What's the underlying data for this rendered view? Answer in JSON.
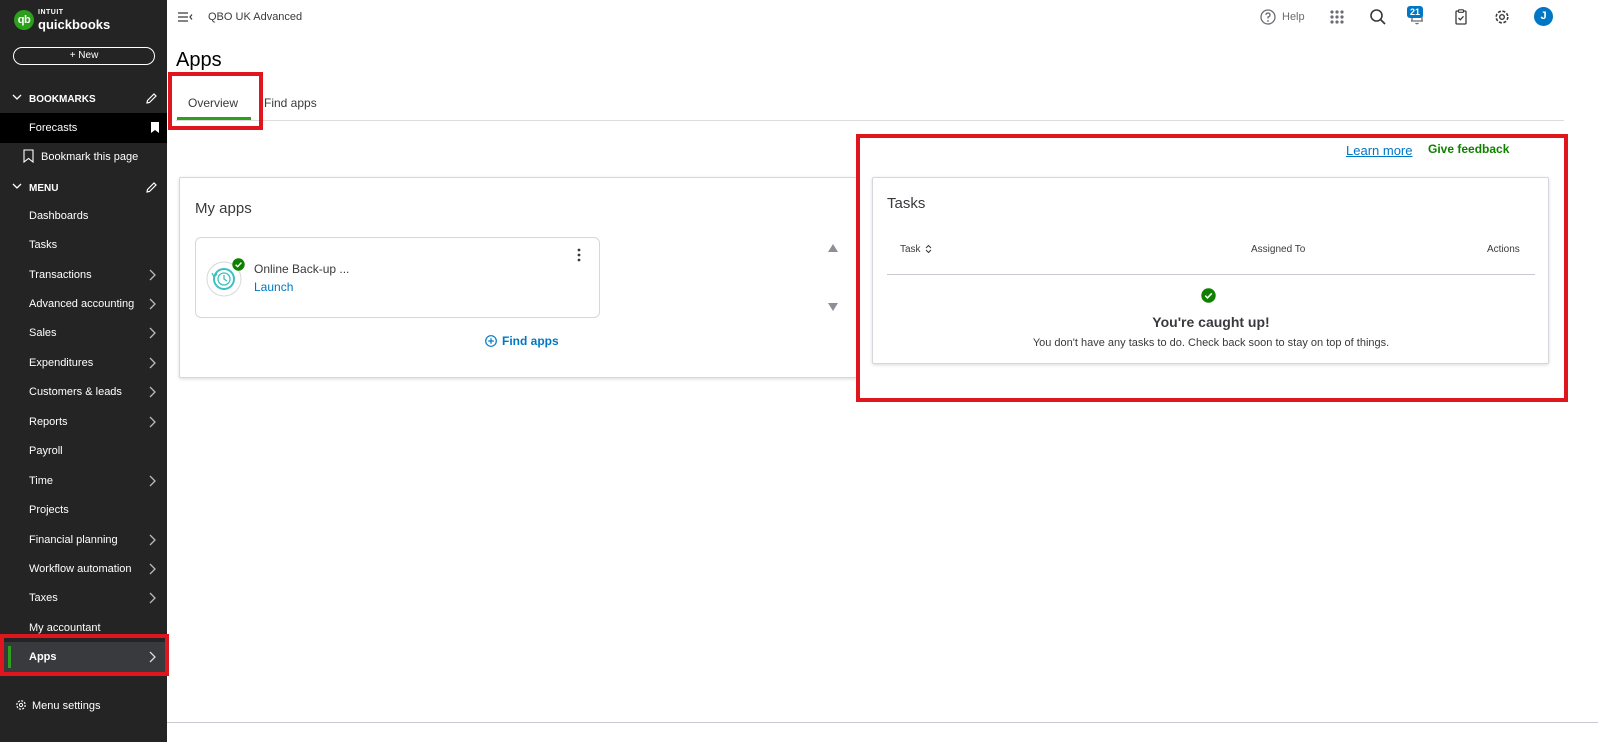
{
  "brand": {
    "intuit": "INTUIT",
    "product": "quickbooks",
    "mark": "qb"
  },
  "sidebar": {
    "new_label": "+  New",
    "bookmarks_heading": "BOOKMARKS",
    "bookmarks": [
      {
        "label": "Forecasts"
      }
    ],
    "bookmark_this_page": "Bookmark this page",
    "menu_heading": "MENU",
    "items": [
      {
        "label": "Dashboards"
      },
      {
        "label": "Tasks"
      },
      {
        "label": "Transactions"
      },
      {
        "label": "Advanced accounting"
      },
      {
        "label": "Sales"
      },
      {
        "label": "Expenditures"
      },
      {
        "label": "Customers & leads"
      },
      {
        "label": "Reports"
      },
      {
        "label": "Payroll"
      },
      {
        "label": "Time"
      },
      {
        "label": "Projects"
      },
      {
        "label": "Financial planning"
      },
      {
        "label": "Workflow automation"
      },
      {
        "label": "Taxes"
      },
      {
        "label": "My accountant"
      },
      {
        "label": "Apps"
      }
    ],
    "menu_settings": "Menu settings"
  },
  "topbar": {
    "company": "QBO UK Advanced",
    "help": "Help",
    "notification_count": "21",
    "avatar_initial": "J"
  },
  "page": {
    "title": "Apps",
    "tabs": [
      {
        "label": "Overview"
      },
      {
        "label": "Find apps"
      }
    ],
    "learn_more": "Learn more",
    "give_feedback": "Give feedback"
  },
  "my_apps": {
    "title": "My apps",
    "app": {
      "name": "Online Back-up ...",
      "action": "Launch"
    },
    "find_apps": "Find apps"
  },
  "tasks": {
    "title": "Tasks",
    "columns": [
      "Task",
      "Assigned To",
      "Actions"
    ],
    "empty_title": "You're caught up!",
    "empty_message": "You don't have any tasks to do. Check back soon to stay on top of things."
  },
  "colors": {
    "brand_green": "#2ca01c",
    "link_blue": "#0077c5",
    "sidebar_bg": "#242424",
    "highlight_red": "#e0161f"
  }
}
